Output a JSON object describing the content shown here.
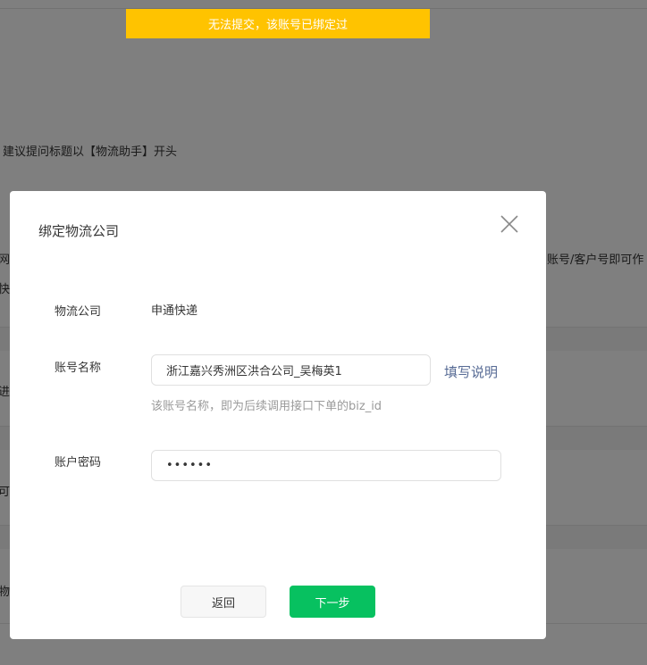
{
  "background": {
    "hint": "建议提问标题以【物流助手】开头",
    "fragments": {
      "left1": "网",
      "left2": "快",
      "left3": "进",
      "left4": "可",
      "left5": "物",
      "right1": "账号/客户号即可作"
    }
  },
  "toast": {
    "text": "无法提交，该账号已绑定过",
    "color": "#ffc300"
  },
  "dialog": {
    "title": "绑定物流公司",
    "close_icon": "close-icon",
    "company": {
      "label": "物流公司",
      "value": "申通快递"
    },
    "account": {
      "label": "账号名称",
      "value": "浙江嘉兴秀洲区洪合公司_吴梅英1",
      "help_link": "填写说明",
      "tip": "该账号名称，即为后续调用接口下单的biz_id"
    },
    "password": {
      "label": "账户密码",
      "value": "••••••"
    },
    "buttons": {
      "back": "返回",
      "next": "下一步"
    },
    "colors": {
      "primary": "#07c160",
      "link": "#576b95"
    }
  }
}
